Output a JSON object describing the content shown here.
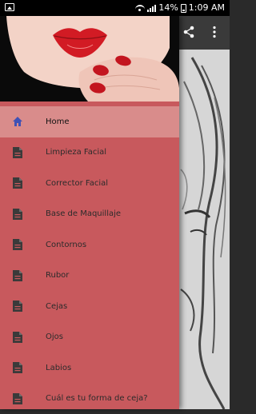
{
  "status_bar": {
    "battery_percent": "14%",
    "time": "1:09 AM",
    "icons": [
      "image-icon",
      "wifi-icon",
      "signal-icon",
      "battery-icon"
    ]
  },
  "app_bar": {
    "icons": [
      "share-icon",
      "more-vert-icon"
    ]
  },
  "drawer": {
    "accent_color": "#c8595d",
    "active_color": "#d98c8b",
    "items": [
      {
        "label": "Home",
        "icon": "home-icon"
      },
      {
        "label": "Limpieza Facial",
        "icon": "document-icon"
      },
      {
        "label": "Corrector Facial",
        "icon": "document-icon"
      },
      {
        "label": "Base de Maquillaje",
        "icon": "document-icon"
      },
      {
        "label": "Contornos",
        "icon": "document-icon"
      },
      {
        "label": "Rubor",
        "icon": "document-icon"
      },
      {
        "label": "Cejas",
        "icon": "document-icon"
      },
      {
        "label": "Ojos",
        "icon": "document-icon"
      },
      {
        "label": "Labios",
        "icon": "document-icon"
      },
      {
        "label": "Cuál es tu forma de ceja?",
        "icon": "document-icon"
      }
    ]
  }
}
